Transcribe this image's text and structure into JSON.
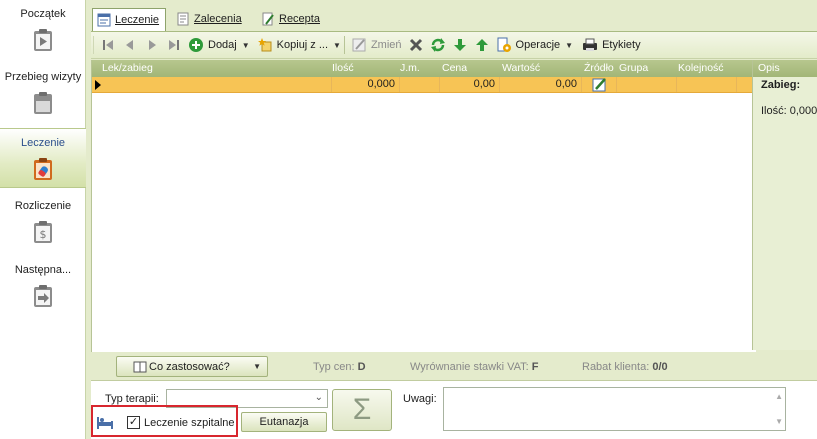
{
  "nav": {
    "items": [
      {
        "label": "Początek"
      },
      {
        "label": "Przebieg wizyty"
      },
      {
        "label": "Leczenie"
      },
      {
        "label": "Rozliczenie"
      },
      {
        "label": "Następna..."
      }
    ]
  },
  "tabs": [
    {
      "label": "Leczenie"
    },
    {
      "label": "Zalecenia"
    },
    {
      "label": "Recepta"
    }
  ],
  "toolbar": {
    "dodaj": "Dodaj",
    "kopiuj": "Kopiuj z ...",
    "zmien": "Zmień",
    "operacje": "Operacje",
    "etykiety": "Etykiety"
  },
  "grid": {
    "columns": [
      "Lek/zabieg",
      "Ilość",
      "J.m.",
      "Cena",
      "Wartość",
      "Źródło",
      "Grupa",
      "Kolejność"
    ],
    "row": {
      "ilosc": "0,000",
      "cena": "0,00",
      "wartosc": "0,00"
    }
  },
  "opis": {
    "header": "Opis",
    "zabieg": "Zabieg:",
    "ilosc": "Ilość: 0,000"
  },
  "status": {
    "co_zastosowac": "Co zastosować?",
    "typ_cen_label": "Typ cen:",
    "typ_cen_value": "D",
    "vat_label": "Wyrównanie stawki VAT:",
    "vat_value": "F",
    "rabat_label": "Rabat klienta:",
    "rabat_value": "0/0"
  },
  "form": {
    "typ_terapii_label": "Typ terapii:",
    "typ_terapii_value": "",
    "leczenie_szpitalne": "Leczenie szpitalne",
    "leczenie_szpitalne_checked": true,
    "eutanazja": "Eutanazja",
    "sum_symbol": "Σ",
    "uwagi_label": "Uwagi:",
    "uwagi_value": ""
  }
}
